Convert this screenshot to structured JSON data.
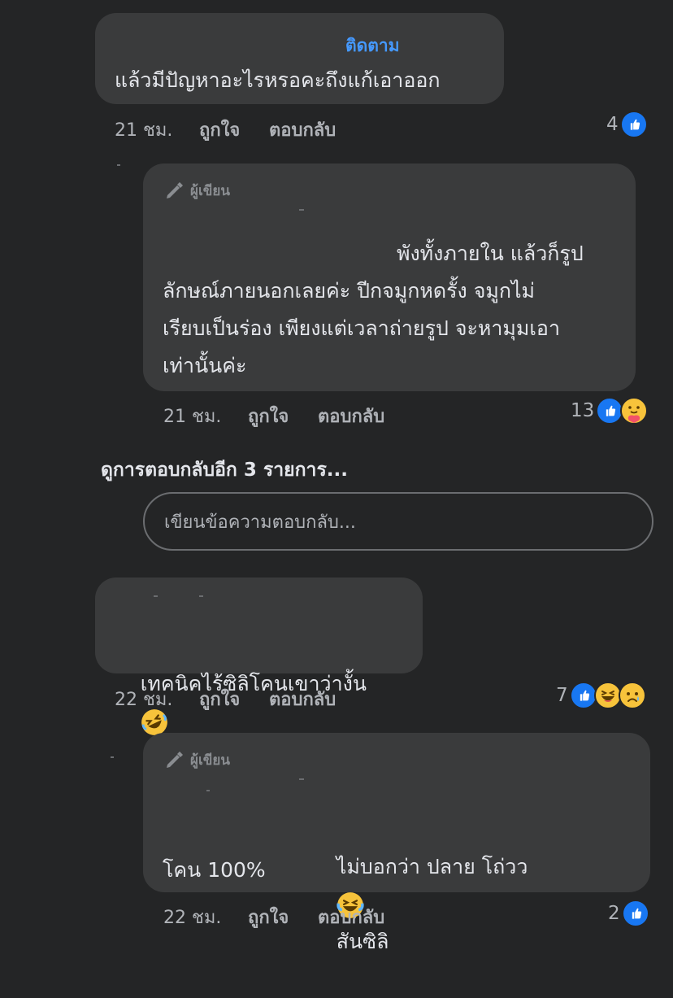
{
  "comment1": {
    "follow_label": "ติดตาม",
    "text": "แล้วมีปัญหาอะไรหรอคะถึงแก้เอาออก",
    "time": "21 ชม.",
    "like_label": "ถูกใจ",
    "reply_label": "ตอบกลับ",
    "reaction_count": "4"
  },
  "reply1": {
    "author_badge": "ผู้เขียน",
    "line1": "พังทั้งภายใน แล้วก็รูป",
    "line2": "ลักษณ์ภายนอกเลยค่ะ ปีกจมูกหดรั้ง จมูกไม่",
    "line3": "เรียบเป็นร่อง เพียงแต่เวลาถ่ายรูป จะหามุมเอา",
    "line4": "เท่านั้นค่ะ",
    "time": "21 ชม.",
    "like_label": "ถูกใจ",
    "reply_label": "ตอบกลับ",
    "reaction_count": "13"
  },
  "more_replies_label": "ดูการตอบกลับอีก 3 รายการ...",
  "reply_input": {
    "placeholder": "เขียนข้อความตอบกลับ..."
  },
  "comment2": {
    "text": "เทคนิคไร้ซิลิโคนเขาว่างั้น",
    "time": "22 ชม.",
    "like_label": "ถูกใจ",
    "reply_label": "ตอบกลับ",
    "reaction_count": "7"
  },
  "reply2": {
    "author_badge": "ผู้เขียน",
    "line1": "ไม่บอกว่า ปลาย โถ่วว",
    "line1b": "สันซิลิ",
    "line2": "โคน 100%",
    "time": "22 ชม.",
    "like_label": "ถูกใจ",
    "reply_label": "ตอบกลับ",
    "reaction_count": "2"
  },
  "colors": {
    "background": "#242526",
    "bubble": "#3a3b3c",
    "accent": "#4599ff",
    "like": "#1877f2"
  },
  "icons": [
    "like-icon",
    "care-icon",
    "haha-icon",
    "sad-icon",
    "pen-icon",
    "rofl-emoji",
    "tears-of-joy-emoji"
  ]
}
